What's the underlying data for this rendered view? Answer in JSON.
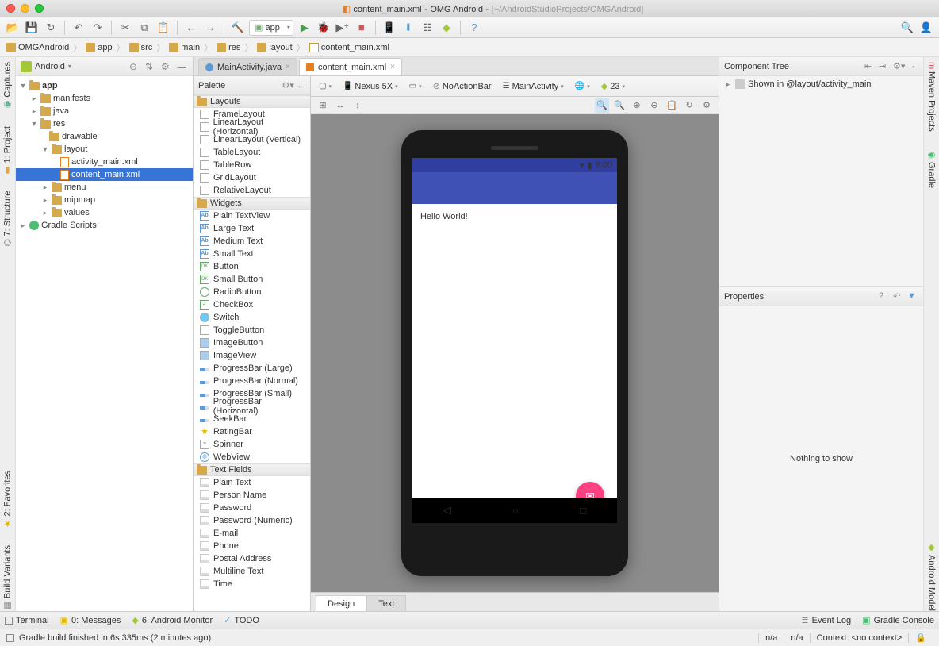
{
  "titlebar": {
    "filename": "content_main.xml",
    "project": "OMG Android",
    "path": "[~/AndroidStudioProjects/OMGAndroid]"
  },
  "run_config": "app",
  "breadcrumb": [
    "OMGAndroid",
    "app",
    "src",
    "main",
    "res",
    "layout",
    "content_main.xml"
  ],
  "project_view_mode": "Android",
  "tree": {
    "app": "app",
    "manifests": "manifests",
    "java": "java",
    "res": "res",
    "drawable": "drawable",
    "layout": "layout",
    "activity_main": "activity_main.xml",
    "content_main": "content_main.xml",
    "menu": "menu",
    "mipmap": "mipmap",
    "values": "values",
    "gradle": "Gradle Scripts"
  },
  "tabs": [
    {
      "label": "MainActivity.java",
      "active": false
    },
    {
      "label": "content_main.xml",
      "active": true
    }
  ],
  "palette": {
    "title": "Palette",
    "layouts_cat": "Layouts",
    "layouts": [
      "FrameLayout",
      "LinearLayout (Horizontal)",
      "LinearLayout (Vertical)",
      "TableLayout",
      "TableRow",
      "GridLayout",
      "RelativeLayout"
    ],
    "widgets_cat": "Widgets",
    "widgets": [
      "Plain TextView",
      "Large Text",
      "Medium Text",
      "Small Text",
      "Button",
      "Small Button",
      "RadioButton",
      "CheckBox",
      "Switch",
      "ToggleButton",
      "ImageButton",
      "ImageView",
      "ProgressBar (Large)",
      "ProgressBar (Normal)",
      "ProgressBar (Small)",
      "ProgressBar (Horizontal)",
      "SeekBar",
      "RatingBar",
      "Spinner",
      "WebView"
    ],
    "textfields_cat": "Text Fields",
    "textfields": [
      "Plain Text",
      "Person Name",
      "Password",
      "Password (Numeric)",
      "E-mail",
      "Phone",
      "Postal Address",
      "Multiline Text",
      "Time"
    ]
  },
  "canvas_toolbar": {
    "device": "Nexus 5X",
    "theme": "NoActionBar",
    "activity": "MainActivity",
    "api": "23"
  },
  "preview": {
    "time": "6:00",
    "hello": "Hello World!"
  },
  "design_tabs": {
    "design": "Design",
    "text": "Text"
  },
  "component_tree": {
    "title": "Component Tree",
    "shown_in": "Shown in @layout/activity_main"
  },
  "properties": {
    "title": "Properties",
    "empty": "Nothing to show"
  },
  "left_rail": [
    "Captures",
    "1: Project",
    "7: Structure"
  ],
  "right_rail": [
    "Maven Projects",
    "Gradle",
    "Android Model"
  ],
  "bottom_left_rail": [
    "2: Favorites",
    "Build Variants"
  ],
  "bottom_bar": {
    "terminal": "Terminal",
    "messages": "0: Messages",
    "monitor": "6: Android Monitor",
    "todo": "TODO",
    "eventlog": "Event Log",
    "gradleconsole": "Gradle Console"
  },
  "status": {
    "msg": "Gradle build finished in 6s 335ms (2 minutes ago)",
    "context": "Context: <no context>",
    "na1": "n/a",
    "na2": "n/a"
  }
}
